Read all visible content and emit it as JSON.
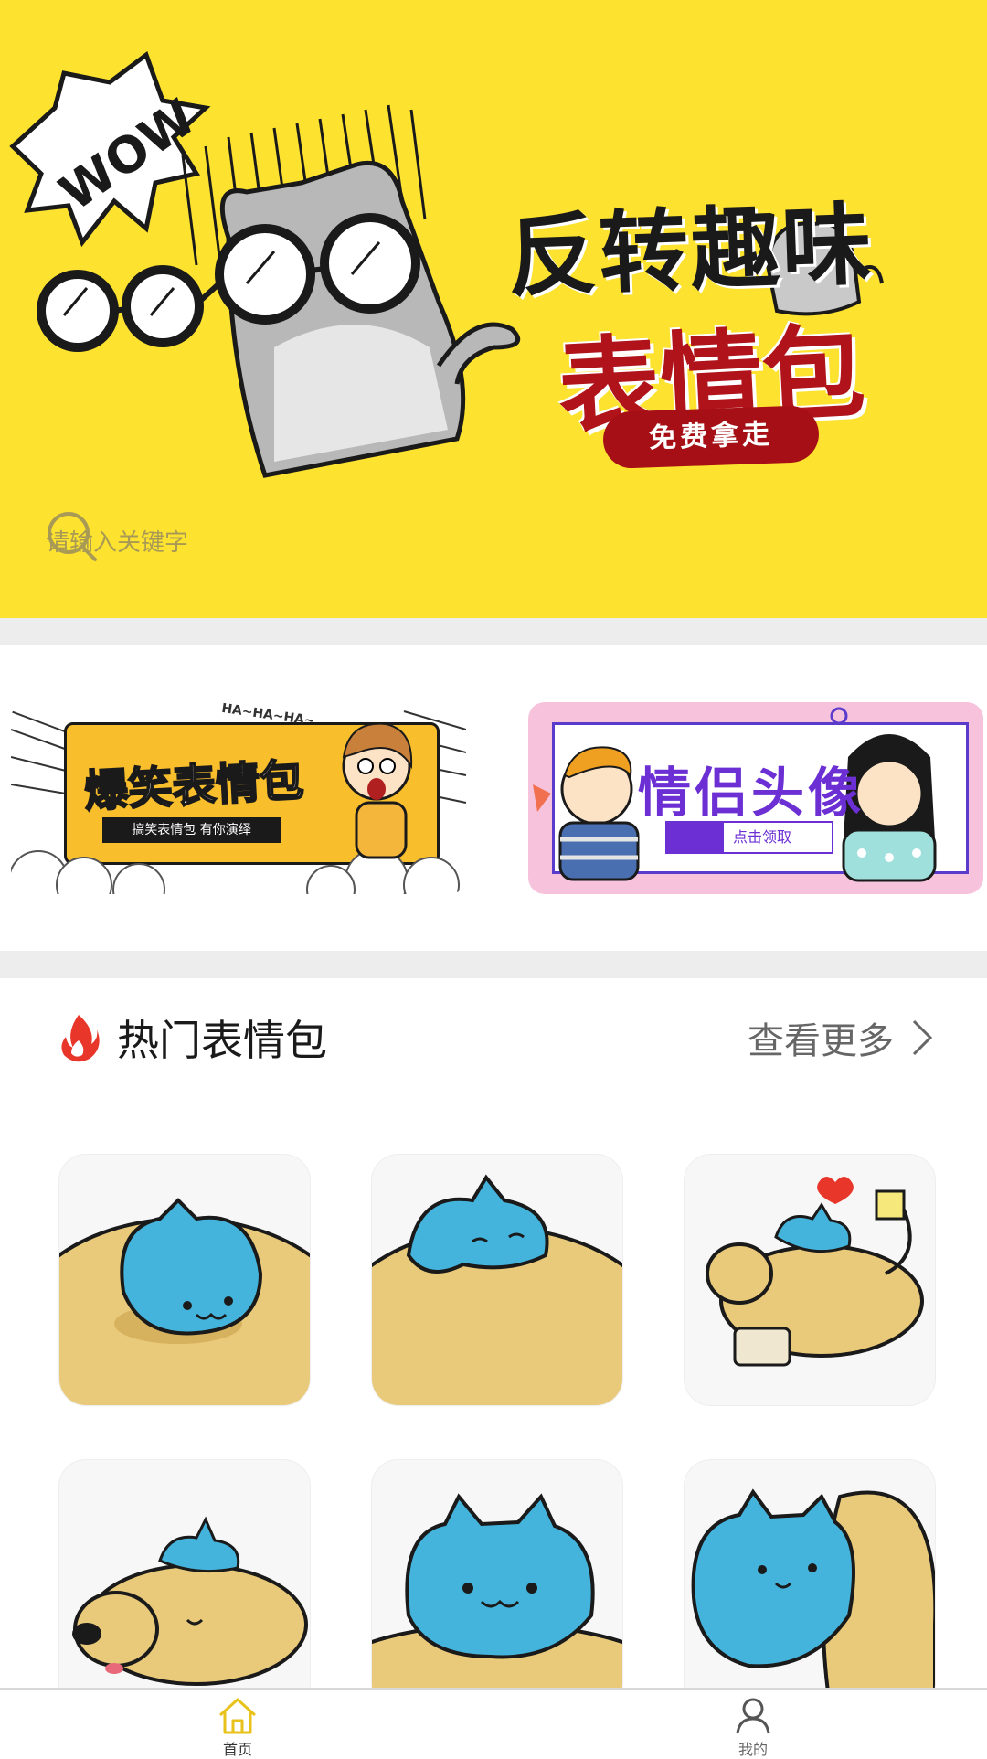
{
  "hero": {
    "wow_text": "WOW",
    "title": "反转趣味",
    "subtitle": "表情包",
    "badge": "免费拿走"
  },
  "search": {
    "placeholder": "请输入关键字"
  },
  "banners": [
    {
      "title": "爆笑表情包",
      "subtitle": "搞笑表情包  有你演绎",
      "tag": "HA~HA~HA~"
    },
    {
      "title": "情侣头像",
      "search_text": "点击领取"
    }
  ],
  "section": {
    "title": "热门表情包",
    "more": "查看更多"
  },
  "tabs": [
    {
      "label": "首页",
      "icon": "home-icon",
      "active": true
    },
    {
      "label": "我的",
      "icon": "user-icon",
      "active": false
    }
  ],
  "colors": {
    "hero_bg": "#fde22f",
    "brand_red": "#b0141a",
    "cat_blue": "#45b4dc",
    "dog_tan": "#e9c97a"
  }
}
